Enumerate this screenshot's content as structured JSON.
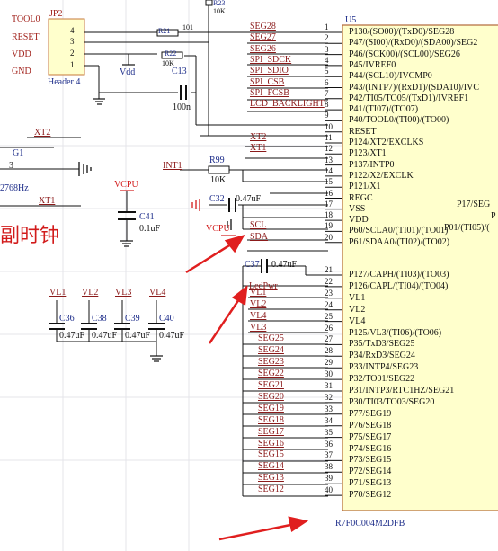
{
  "header_connector": {
    "designator": "JP2",
    "name": "Header 4",
    "pins": [
      {
        "num": "4",
        "net": "TOOL0"
      },
      {
        "num": "3",
        "net": "RESET"
      },
      {
        "num": "2",
        "net": "VDD"
      },
      {
        "num": "1",
        "net": "GND"
      }
    ]
  },
  "resistors": {
    "r23": {
      "ref": "R23",
      "value": "10K"
    },
    "r21": {
      "ref": "R21",
      "value": "101"
    },
    "r22": {
      "ref": "R22",
      "value": "10K"
    },
    "r99": {
      "ref": "R99",
      "value": "10K"
    }
  },
  "caps": {
    "c13": {
      "ref": "C13",
      "value": "100n"
    },
    "c41": {
      "ref": "C41",
      "value": "0.1uF"
    },
    "c32": {
      "ref": "C32",
      "value": "0.47uF"
    },
    "c37": {
      "ref": "C37",
      "value": "0.47uF"
    },
    "c36": {
      "ref": "C36",
      "value": "0.47uF"
    },
    "c38": {
      "ref": "C38",
      "value": "0.47uF"
    },
    "c39": {
      "ref": "C39",
      "value": "0.47uF"
    },
    "c40": {
      "ref": "C40",
      "value": "0.47uF"
    }
  },
  "misc": {
    "vdd": "Vdd",
    "vcpu": "VCPU",
    "vcpu2": "VCPU",
    "g1": "G1",
    "g1pin": "3",
    "freq": "2768Hz",
    "xt2_left": "XT2",
    "xt1_left": "XT1",
    "int1": "INT1",
    "chinese": "副时钟",
    "ledpwr": "LedPwr",
    "vl_top": [
      "VL1",
      "VL2",
      "VL3",
      "VL4"
    ]
  },
  "ic": {
    "designator": "U5",
    "part": "R7F0C004M2DFB",
    "pins": [
      {
        "num": "1",
        "net": "SEG28",
        "func": "P130/(SO00)/(TxD0)/SEG28"
      },
      {
        "num": "2",
        "net": "SEG27",
        "func": "P47/(SI00)/(RxD0)/(SDA00)/SEG2"
      },
      {
        "num": "3",
        "net": "SEG26",
        "func": "P46/(SCK00)/(SCL00)/SEG26"
      },
      {
        "num": "4",
        "net": "SPI_SDCK",
        "func": "P45/IVREF0"
      },
      {
        "num": "5",
        "net": "SPI_SDIO",
        "func": "P44/(SCL10)/IVCMP0"
      },
      {
        "num": "6",
        "net": "SPI_CSB",
        "func": "P43/(INTP7)/(RxD1)/(SDA10)/IVC"
      },
      {
        "num": "7",
        "net": "SPI_FCSB",
        "func": "P42/TI05/TO05/(TxD1)/IVREF1"
      },
      {
        "num": "8",
        "net": "LCD_BACKLIGHT",
        "func": "P41/(TI07)/(TO07)"
      },
      {
        "num": "9",
        "net": "",
        "func": "P40/TOOL0/(TI00)/(TO00)"
      },
      {
        "num": "10",
        "net": "",
        "func": "RESET"
      },
      {
        "num": "11",
        "net": "XT2",
        "func": "P124/XT2/EXCLKS"
      },
      {
        "num": "12",
        "net": "XT1",
        "func": "P123/XT1"
      },
      {
        "num": "13",
        "net": "",
        "func": "P137/INTP0"
      },
      {
        "num": "14",
        "net": "",
        "func": "P122/X2/EXCLK"
      },
      {
        "num": "15",
        "net": "",
        "func": "P121/X1"
      },
      {
        "num": "16",
        "net": "",
        "func": "REGC"
      },
      {
        "num": "17",
        "net": "",
        "func": "VSS"
      },
      {
        "num": "18",
        "net": "",
        "func": "VDD"
      },
      {
        "num": "19",
        "net": "SCL",
        "func": "P60/SCLA0/(TI01)/(TO01)"
      },
      {
        "num": "20",
        "net": "SDA",
        "func": "P61/SDAA0/(TI02)/(TO02)"
      },
      {
        "num": "21",
        "net": "",
        "func": "P127/CAPH/(TI03)/(TO03)"
      },
      {
        "num": "22",
        "net": "",
        "func": "P126/CAPL/(TI04)/(TO04)"
      },
      {
        "num": "23",
        "net": "VL1",
        "func": "VL1"
      },
      {
        "num": "24",
        "net": "VL2",
        "func": "VL2"
      },
      {
        "num": "25",
        "net": "VL4",
        "func": "VL4"
      },
      {
        "num": "26",
        "net": "VL3",
        "func": "P125/VL3/(TI06)/(TO06)"
      },
      {
        "num": "27",
        "net": "SEG25",
        "func": "P35/TxD3/SEG25"
      },
      {
        "num": "28",
        "net": "SEG24",
        "func": "P34/RxD3/SEG24"
      },
      {
        "num": "29",
        "net": "SEG23",
        "func": "P33/INTP4/SEG23"
      },
      {
        "num": "30",
        "net": "SEG22",
        "func": "P32/TO01/SEG22"
      },
      {
        "num": "31",
        "net": "SEG21",
        "func": "P31/INTP3/RTC1HZ/SEG21"
      },
      {
        "num": "32",
        "net": "SEG20",
        "func": "P30/TI03/TO03/SEG20"
      },
      {
        "num": "33",
        "net": "SEG19",
        "func": "P77/SEG19"
      },
      {
        "num": "34",
        "net": "SEG18",
        "func": "P76/SEG18"
      },
      {
        "num": "35",
        "net": "SEG17",
        "func": "P75/SEG17"
      },
      {
        "num": "36",
        "net": "SEG16",
        "func": "P74/SEG16"
      },
      {
        "num": "37",
        "net": "SEG15",
        "func": "P73/SEG15"
      },
      {
        "num": "38",
        "net": "SEG14",
        "func": "P72/SEG14"
      },
      {
        "num": "39",
        "net": "SEG13",
        "func": "P71/SEG13"
      },
      {
        "num": "40",
        "net": "SEG12",
        "func": "P70/SEG12"
      }
    ],
    "right_side": [
      {
        "num": "",
        "func": "P17/SEG"
      },
      {
        "num": "",
        "func": "P"
      },
      {
        "num": "",
        "func": "P01/(TI05)/("
      }
    ]
  }
}
